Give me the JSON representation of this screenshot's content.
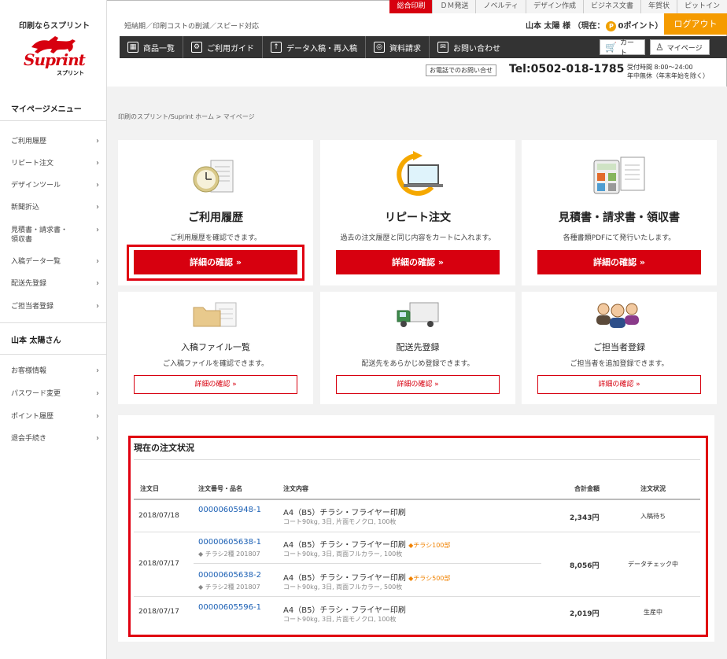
{
  "top_links": [
    "総合印刷",
    "ＤＭ発送",
    "ノベルティ",
    "デザイン作成",
    "ビジネス文書",
    "年賀状",
    "ピットイン"
  ],
  "tagline": "短納期／印刷コストの削減／スピード対応",
  "brand": {
    "tag": "印刷ならスプリント",
    "logo_word": "Suprint",
    "logo_kana": "スプリント"
  },
  "user": {
    "name": "山本 太陽 様",
    "points_prefix": "（現在：",
    "points_value": "0",
    "points_suffix": "ポイント）",
    "coin": "P"
  },
  "logout_label": "ログアウト",
  "nav": [
    {
      "label": "商品一覧",
      "icon": "grid-icon"
    },
    {
      "label": "ご利用ガイド",
      "icon": "guide-icon"
    },
    {
      "label": "データ入稿・再入稿",
      "icon": "upload-icon"
    },
    {
      "label": "資料請求",
      "icon": "document-icon"
    },
    {
      "label": "お問い合わせ",
      "icon": "mail-icon"
    }
  ],
  "cart_label": "カート",
  "mypage_label": "マイページ",
  "phone": {
    "label": "お電話でのお問い合せ",
    "number": "Tel:0502-018-1785",
    "hours1": "受付時間 8:00～24:00",
    "hours2": "年中無休（年末年始を除く）"
  },
  "sidebar": {
    "menu_title": "マイページメニュー",
    "items": [
      "ご利用履歴",
      "リピート注文",
      "デザインツール",
      "新聞折込",
      "見積書・請求書・\n領収書",
      "入稿データ一覧",
      "配送先登録",
      "ご担当者登録"
    ],
    "user_title": "山本 太陽さん",
    "user_items": [
      "お客様情報",
      "パスワード変更",
      "ポイント履歴",
      "退会手続き"
    ]
  },
  "breadcrumb": "印刷のスプリント/Suprint ホーム  >  マイページ",
  "cards": [
    {
      "title": "ご利用履歴",
      "desc": "ご利用履歴を確認できます。",
      "button": "詳細の確認 »"
    },
    {
      "title": "リピート注文",
      "desc": "過去の注文履歴と同じ内容をカートに入れます。",
      "button": "詳細の確認 »"
    },
    {
      "title": "見積書・請求書・領収書",
      "desc": "各種書類PDFにて発行いたします。",
      "button": "詳細の確認 »"
    },
    {
      "title": "入稿ファイル一覧",
      "desc": "ご入稿ファイルを確認できます。",
      "button": "詳細の確認 »"
    },
    {
      "title": "配送先登録",
      "desc": "配送先をあらかじめ登録できます。",
      "button": "詳細の確認 »"
    },
    {
      "title": "ご担当者登録",
      "desc": "ご担当者を追加登録できます。",
      "button": "詳細の確認 »"
    }
  ],
  "orders": {
    "title": "現在の注文状況",
    "headers": [
      "注文日",
      "注文番号・品名",
      "注文内容",
      "合計金額",
      "注文状況"
    ],
    "rows": [
      {
        "date": "2018/07/18",
        "items": [
          {
            "no": "00000605948-1",
            "tag": "",
            "name": "A4（B5）チラシ・フライヤー印刷",
            "name_tag": "",
            "spec": "コート90kg, 3日, 片面モノクロ, 100枚"
          }
        ],
        "total": "2,343円",
        "status": "入稿待ち"
      },
      {
        "date": "2018/07/17",
        "items": [
          {
            "no": "00000605638-1",
            "tag": "チラシ2種 201807",
            "name": "A4（B5）チラシ・フライヤー印刷",
            "name_tag": "チラシ100部",
            "spec": "コート90kg, 3日, 両面フルカラー, 100枚"
          },
          {
            "no": "00000605638-2",
            "tag": "チラシ2種 201807",
            "name": "A4（B5）チラシ・フライヤー印刷",
            "name_tag": "チラシ500部",
            "spec": "コート90kg, 3日, 両面フルカラー, 500枚"
          }
        ],
        "total": "8,056円",
        "status": "データチェック中"
      },
      {
        "date": "2018/07/17",
        "items": [
          {
            "no": "00000605596-1",
            "tag": "",
            "name": "A4（B5）チラシ・フライヤー印刷",
            "name_tag": "",
            "spec": "コート90kg, 3日, 片面モノクロ, 100枚"
          }
        ],
        "total": "2,019円",
        "status": "生産中"
      }
    ]
  },
  "colors": {
    "accent_red": "#d7000f",
    "logout_orange": "#f59b00",
    "nav_dark": "#333333",
    "link_blue": "#1a5fb4"
  }
}
